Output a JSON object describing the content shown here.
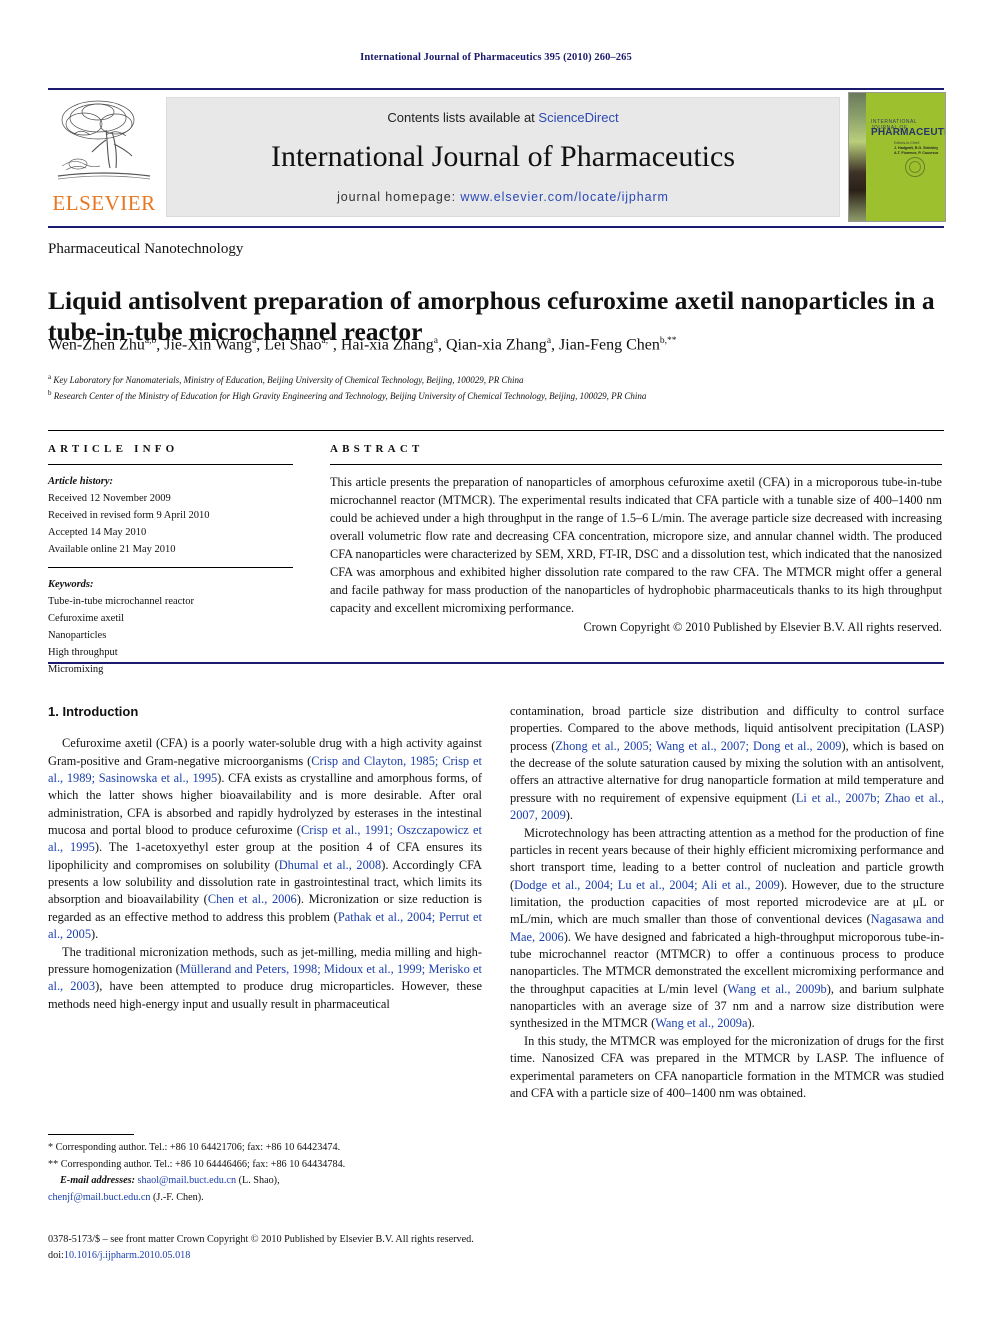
{
  "running_head": "International Journal of Pharmaceutics 395 (2010) 260–265",
  "masthead": {
    "publisher_name": "ELSEVIER",
    "contents_prefix": "Contents lists available at ",
    "contents_link": "ScienceDirect",
    "journal_title": "International Journal of Pharmaceutics",
    "homepage_label": "journal homepage: ",
    "homepage_url": "www.elsevier.com/locate/ijpharm",
    "cover": {
      "line1": "INTERNATIONAL JOURNAL OF",
      "line2": "PHARMACEUTICS",
      "line3": "Editors-in-Chief:",
      "line4": "J. Hadgraft, R.G. Strickley",
      "line5": "A.T. Florence, P. Couvreur"
    },
    "accent_blue": "#1a1a6e",
    "link_blue": "#2b49b5",
    "elsevier_orange": "#E87722",
    "cover_green": "#9dc02e"
  },
  "section_name": "Pharmaceutical Nanotechnology",
  "title": "Liquid antisolvent preparation of amorphous cefuroxime axetil nanoparticles in a tube-in-tube microchannel reactor",
  "authors": [
    {
      "name": "Wen-Zhen Zhu",
      "marks": "a,b"
    },
    {
      "name": "Jie-Xin Wang",
      "marks": "a"
    },
    {
      "name": "Lei Shao",
      "marks": "a,*"
    },
    {
      "name": "Hai-xia Zhang",
      "marks": "a"
    },
    {
      "name": "Qian-xia Zhang",
      "marks": "a"
    },
    {
      "name": "Jian-Feng Chen",
      "marks": "b,**"
    }
  ],
  "affiliations": [
    {
      "mark": "a",
      "text": "Key Laboratory for Nanomaterials, Ministry of Education, Beijing University of Chemical Technology, Beijing, 100029, PR China"
    },
    {
      "mark": "b",
      "text": "Research Center of the Ministry of Education for High Gravity Engineering and Technology, Beijing University of Chemical Technology, Beijing, 100029, PR China"
    }
  ],
  "article_info": {
    "heading": "ARTICLE INFO",
    "history_label": "Article history:",
    "history": [
      "Received 12 November 2009",
      "Received in revised form 9 April 2010",
      "Accepted 14 May 2010",
      "Available online 21 May 2010"
    ],
    "keywords_label": "Keywords:",
    "keywords": [
      "Tube-in-tube microchannel reactor",
      "Cefuroxime axetil",
      "Nanoparticles",
      "High throughput",
      "Micromixing"
    ]
  },
  "abstract": {
    "heading": "ABSTRACT",
    "text": "This article presents the preparation of nanoparticles of amorphous cefuroxime axetil (CFA) in a microporous tube-in-tube microchannel reactor (MTMCR). The experimental results indicated that CFA particle with a tunable size of 400–1400 nm could be achieved under a high throughput in the range of 1.5–6 L/min. The average particle size decreased with increasing overall volumetric flow rate and decreasing CFA concentration, micropore size, and annular channel width. The produced CFA nanoparticles were characterized by SEM, XRD, FT-IR, DSC and a dissolution test, which indicated that the nanosized CFA was amorphous and exhibited higher dissolution rate compared to the raw CFA. The MTMCR might offer a general and facile pathway for mass production of the nanoparticles of hydrophobic pharmaceuticals thanks to its high throughput capacity and excellent micromixing performance.",
    "copyright": "Crown Copyright © 2010 Published by Elsevier B.V. All rights reserved."
  },
  "body": {
    "intro_heading": "1. Introduction",
    "left_paragraphs": [
      {
        "runs": [
          {
            "t": "Cefuroxime axetil (CFA) is a poorly water-soluble drug with a high activity against Gram-positive and Gram-negative microorganisms ("
          },
          {
            "t": "Crisp and Clayton, 1985; Crisp et al., 1989; Sasinowska et al., 1995",
            "cite": true
          },
          {
            "t": "). CFA exists as crystalline and amorphous forms, of which the latter shows higher bioavailability and is more desirable. After oral administration, CFA is absorbed and rapidly hydrolyzed by esterases in the intestinal mucosa and portal blood to produce cefuroxime ("
          },
          {
            "t": "Crisp et al., 1991; Oszczapowicz et al., 1995",
            "cite": true
          },
          {
            "t": "). The 1-acetoxyethyl ester group at the position 4 of CFA ensures its lipophilicity and compromises on solubility ("
          },
          {
            "t": "Dhumal et al., 2008",
            "cite": true
          },
          {
            "t": "). Accordingly CFA presents a low solubility and dissolution rate in gastrointestinal tract, which limits its absorption and bioavailability ("
          },
          {
            "t": "Chen et al., 2006",
            "cite": true
          },
          {
            "t": "). Micronization or size reduction is regarded as an effective method to address this problem ("
          },
          {
            "t": "Pathak et al., 2004; Perrut et al., 2005",
            "cite": true
          },
          {
            "t": ")."
          }
        ]
      },
      {
        "runs": [
          {
            "t": "The traditional micronization methods, such as jet-milling, media milling and high-pressure homogenization ("
          },
          {
            "t": "Müllerand and Peters, 1998; Midoux et al., 1999; Merisko et al., 2003",
            "cite": true
          },
          {
            "t": "), have been attempted to produce drug microparticles. However, these methods need high-energy input and usually result in pharmaceutical"
          }
        ]
      }
    ],
    "right_paragraphs": [
      {
        "runs": [
          {
            "t": "contamination, broad particle size distribution and difficulty to control surface properties. Compared to the above methods, liquid antisolvent precipitation (LASP) process ("
          },
          {
            "t": "Zhong et al., 2005; Wang et al., 2007; Dong et al., 2009",
            "cite": true
          },
          {
            "t": "), which is based on the decrease of the solute saturation caused by mixing the solution with an antisolvent, offers an attractive alternative for drug nanoparticle formation at mild temperature and pressure with no requirement of expensive equipment ("
          },
          {
            "t": "Li et al., 2007b; Zhao et al., 2007, 2009",
            "cite": true
          },
          {
            "t": ")."
          }
        ],
        "no_indent": true
      },
      {
        "runs": [
          {
            "t": "Microtechnology has been attracting attention as a method for the production of fine particles in recent years because of their highly efficient micromixing performance and short transport time, leading to a better control of nucleation and particle growth ("
          },
          {
            "t": "Dodge et al., 2004; Lu et al., 2004; Ali et al., 2009",
            "cite": true
          },
          {
            "t": "). However, due to the structure limitation, the production capacities of most reported microdevice are at μL or mL/min, which are much smaller than those of conventional devices ("
          },
          {
            "t": "Nagasawa and Mae, 2006",
            "cite": true
          },
          {
            "t": "). We have designed and fabricated a high-throughput microporous tube-in-tube microchannel reactor (MTMCR) to offer a continuous process to produce nanoparticles. The MTMCR demonstrated the excellent micromixing performance and the throughput capacities at L/min level ("
          },
          {
            "t": "Wang et al., 2009b",
            "cite": true
          },
          {
            "t": "), and barium sulphate nanoparticles with an average size of 37 nm and a narrow size distribution were synthesized in the MTMCR ("
          },
          {
            "t": "Wang et al., 2009a",
            "cite": true
          },
          {
            "t": ")."
          }
        ]
      },
      {
        "runs": [
          {
            "t": "In this study, the MTMCR was employed for the micronization of drugs for the first time. Nanosized CFA was prepared in the MTMCR by LASP. The influence of experimental parameters on CFA nanoparticle formation in the MTMCR was studied and CFA with a particle size of 400–1400 nm was obtained."
          }
        ]
      }
    ]
  },
  "footnotes": {
    "corr1": "* Corresponding author. Tel.: +86 10 64421706; fax: +86 10 64423474.",
    "corr2": "** Corresponding author. Tel.: +86 10 64446466; fax: +86 10 64434784.",
    "email_label": "E-mail addresses:",
    "email1": "shaol@mail.buct.edu.cn",
    "email1_owner": "(L. Shao),",
    "email2": "chenjf@mail.buct.edu.cn",
    "email2_owner": "(J.-F. Chen)."
  },
  "imprint": {
    "line1": "0378-5173/$ – see front matter Crown Copyright © 2010 Published by Elsevier B.V. All rights reserved.",
    "doi_label": "doi:",
    "doi_value": "10.1016/j.ijpharm.2010.05.018"
  }
}
